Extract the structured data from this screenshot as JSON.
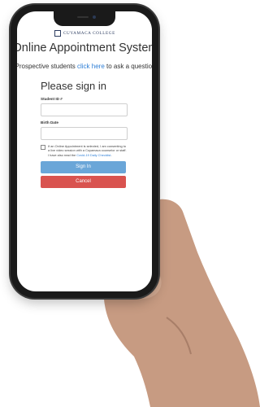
{
  "header": {
    "logo_text": "CUYAMACA COLLEGE",
    "title": "Online Appointment System",
    "subtitle_prefix": "Prospective students ",
    "subtitle_link": "click here",
    "subtitle_suffix": " to ask a question"
  },
  "form": {
    "heading": "Please sign in",
    "student_id_label": "Student ID #",
    "birth_date_label": "Birth Date",
    "consent_text": "If an Online Appointment is selected, I am consenting to a live video session with a Cuyamaca counselor or staff. I have also read the ",
    "consent_link": "Covid-19 Daily Checklist",
    "consent_end": ".",
    "signin_label": "Sign In",
    "cancel_label": "Cancel"
  },
  "colors": {
    "link": "#2f7fd6",
    "primary_button": "#6aa6d8",
    "danger_button": "#d9534f",
    "phone_body": "#1a1a1a"
  }
}
